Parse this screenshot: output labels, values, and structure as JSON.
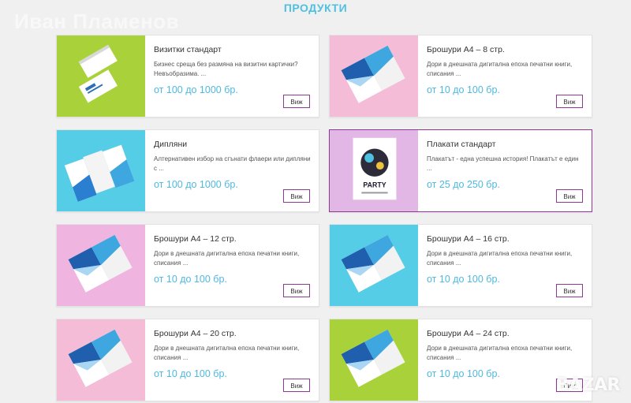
{
  "watermark": "Иван Пламенов",
  "section_title": "ПРОДУКТИ",
  "colors": {
    "accent": "#4fb8df",
    "button_border": "#8e3a93",
    "lime": "#a9d23a",
    "pink": "#f4bcd6",
    "cyan": "#56cde6",
    "lilac": "#e2b7e6"
  },
  "products": [
    {
      "title": "Визитки стандарт",
      "desc": "Бизнес среща без размяна на визитни картички? Невъобразима. ...",
      "price": "от 100 до 1000 бр.",
      "button": "Виж",
      "bg": "#a9d23a",
      "image": "business-cards"
    },
    {
      "title": "Брошури А4 – 8 стр.",
      "desc": "Дори в днешната дигитална епоха печатни книги, списания ...",
      "price": "от 10 до 100 бр.",
      "button": "Виж",
      "bg": "#f4bcd6",
      "image": "brochure"
    },
    {
      "title": "Дипляни",
      "desc": "Алтернативен избор на сгънати флаери или дипляни с ...",
      "price": "от 100 до 1000 бр.",
      "button": "Виж",
      "bg": "#56cde6",
      "image": "leaflets"
    },
    {
      "title": "Плакати стандарт",
      "desc": "Плакатът - една успешна история! Плакатът е един ...",
      "price": "от 25 до 250 бр.",
      "button": "Виж",
      "bg": "#e2b7e6",
      "image": "poster",
      "poster_text": "PARTY"
    },
    {
      "title": "Брошури А4 – 12 стр.",
      "desc": "Дори в днешната дигитална епоха печатни книги, списания ...",
      "price": "от 10 до 100 бр.",
      "button": "Виж",
      "bg": "#f0b4e0",
      "image": "brochure"
    },
    {
      "title": "Брошури А4 – 16 стр.",
      "desc": "Дори в днешната дигитална епоха печатни книги, списания ...",
      "price": "от 10 до 100 бр.",
      "button": "Виж",
      "bg": "#56cde6",
      "image": "brochure"
    },
    {
      "title": "Брошури А4 – 20 стр.",
      "desc": "Дори в днешната дигитална епоха печатни книги, списания ...",
      "price": "от 10 до 100 бр.",
      "button": "Виж",
      "bg": "#f4bcd6",
      "image": "brochure"
    },
    {
      "title": "Брошури А4 – 24 стр.",
      "desc": "Дори в днешната дигитална епоха печатни книги, списания ...",
      "price": "от 10 до 100 бр.",
      "button": "Виж",
      "bg": "#a9d23a",
      "image": "brochure"
    }
  ],
  "logo_text": "BAZAR"
}
